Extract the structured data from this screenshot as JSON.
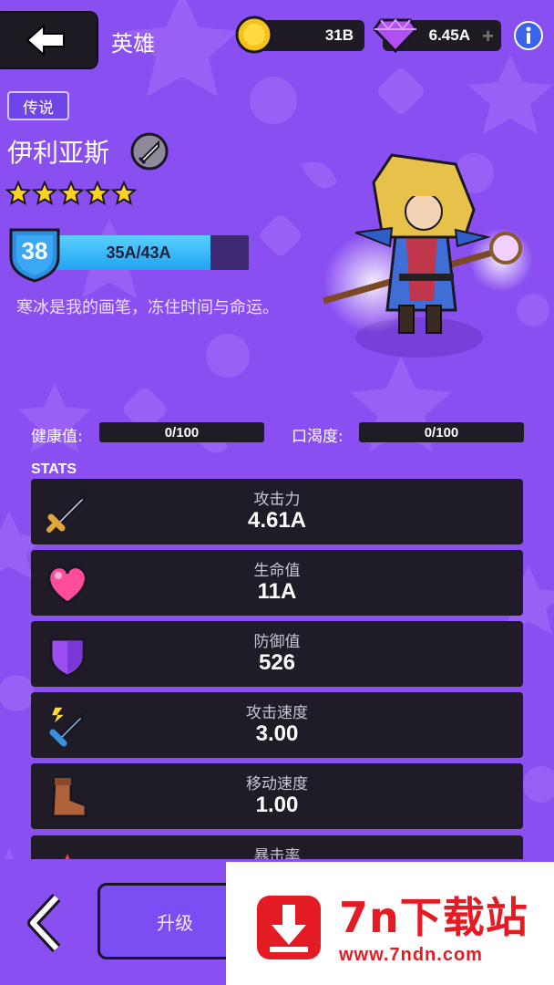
{
  "header": {
    "title": "英雄",
    "coins": "31B",
    "gems": "6.45A",
    "gems_plus": "+"
  },
  "hero": {
    "rarity": "传说",
    "name": "伊利亚斯",
    "stars": 5,
    "level": "38",
    "xp_text": "35A/43A",
    "xp_progress": 0.814,
    "description": "寒冰是我的画笔，冻住时间与命运。"
  },
  "meters": {
    "health_label": "健康值:",
    "health_value": "0/100",
    "thirst_label": "口渴度:",
    "thirst_value": "0/100"
  },
  "stats": {
    "title": "STATS",
    "items": [
      {
        "label": "攻击力",
        "value": "4.61A",
        "icon": "sword-icon"
      },
      {
        "label": "生命值",
        "value": "11A",
        "icon": "heart-icon"
      },
      {
        "label": "防御值",
        "value": "526",
        "icon": "shield-icon"
      },
      {
        "label": "攻击速度",
        "value": "3.00",
        "icon": "attack-speed-icon"
      },
      {
        "label": "移动速度",
        "value": "1.00",
        "icon": "boot-icon"
      },
      {
        "label": "暴击率",
        "value": "",
        "icon": "crit-icon"
      }
    ]
  },
  "bottom": {
    "upgrade_label": "升级"
  },
  "watermark": {
    "brand": "7n下载站",
    "url": "www.7ndn.com"
  },
  "colors": {
    "background": "#8a4ff0",
    "panel": "#1f1c27",
    "xp_fill": "#21a4ef",
    "watermark_red": "#e41b23"
  }
}
